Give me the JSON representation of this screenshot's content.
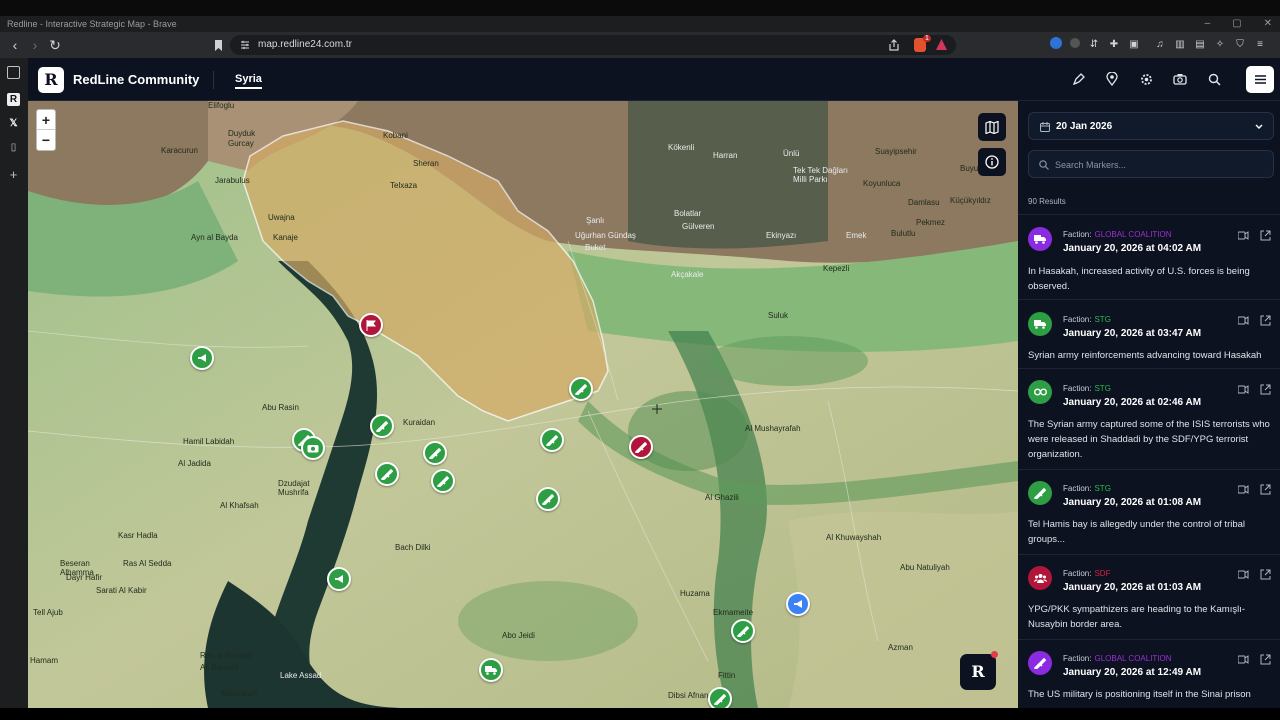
{
  "browser": {
    "window_title": "Redline - Interactive Strategic Map - Brave",
    "url": "map.redline24.com.tr",
    "brave_badge": "1"
  },
  "app": {
    "logo_letter": "R",
    "brand": "RedLine Community",
    "tab": "Syria"
  },
  "map": {
    "zoom_in": "+",
    "zoom_out": "−",
    "labels": [
      "Elifoglu",
      "Duyduk",
      "Gurcay",
      "Karacurun",
      "Kobani",
      "Sheran",
      "Telxaza",
      "Jarabulus",
      "Uwajna",
      "Kanaje",
      "Ayn al Bayda",
      "Kökenli",
      "Harran",
      "Ünlü",
      "Tek Tek Dağları Milli Parkı",
      "Suayipsehir",
      "Koyunluca",
      "Damlasu",
      "Pekmez",
      "Küçükyıldız",
      "Buyu",
      "Şanlı",
      "Uğurhan Gündaş",
      "Buket",
      "Bolatlar",
      "Gülveren",
      "Akçakale",
      "Ekinyazı",
      "Emek",
      "Bulutlu",
      "Kepezli",
      "Suluk",
      "Abu Rasin",
      "Kuraidan",
      "Al Mushayrafah",
      "Hamil Labidah",
      "Al Jadida",
      "Al Khafsah",
      "Dzudajat Mushrifa",
      "Bach Dilki",
      "Kasr Hadla",
      "Beseran Alhamma",
      "Ras Al Sedda",
      "Sarati Al Kabir",
      "Dayr Hafir",
      "Tell Ajub",
      "Ras al Bumani",
      "Ali Bumani",
      "Maskanah",
      "Lake Assad",
      "Abo Jeidi",
      "Al Ghazili",
      "Al Khuwayshah",
      "Abu Natuliyah",
      "Huzama",
      "Ekmameite",
      "Azman",
      "Fittin",
      "Dibsi Afnan",
      "Hamam"
    ]
  },
  "panel": {
    "date": "20 Jan 2026",
    "search_placeholder": "Search Markers...",
    "results": "90 Results",
    "faction_label": "Faction:",
    "items": [
      {
        "faction": "GLOBAL COALITION",
        "faction_color": "#9b2fd4",
        "icon": "truck-icon",
        "icon_bg": "#8a2be2",
        "time": "January 20, 2026 at 04:02 AM",
        "text": "In Hasakah, increased activity of U.S. forces is being observed."
      },
      {
        "faction": "STG",
        "faction_color": "#2eb84b",
        "icon": "truck-icon",
        "icon_bg": "#2e9e44",
        "time": "January 20, 2026 at 03:47 AM",
        "text": "Syrian army reinforcements advancing toward Hasakah"
      },
      {
        "faction": "STG",
        "faction_color": "#2eb84b",
        "icon": "handcuffs-icon",
        "icon_bg": "#2e9e44",
        "time": "January 20, 2026 at 02:46 AM",
        "text": "The Syrian army captured some of the ISIS terrorists who were released in Shaddadi by the SDF/YPG terrorist organization."
      },
      {
        "faction": "STG",
        "faction_color": "#2eb84b",
        "icon": "rifle-icon",
        "icon_bg": "#2e9e44",
        "time": "January 20, 2026 at 01:08 AM",
        "text": "Tel Hamis bay is allegedly under the control of tribal groups..."
      },
      {
        "faction": "SDF",
        "faction_color": "#d4213d",
        "icon": "group-icon",
        "icon_bg": "#b0163a",
        "time": "January 20, 2026 at 01:03 AM",
        "text": "YPG/PKK sympathizers are heading to the Kamışlı-Nusaybin border area."
      },
      {
        "faction": "GLOBAL COALITION",
        "faction_color": "#9b2fd4",
        "icon": "rifle-icon",
        "icon_bg": "#8a2be2",
        "time": "January 20, 2026 at 12:49 AM",
        "text": "The US military is positioning itself in the Sinai prison"
      }
    ]
  },
  "colors": {
    "header_bg": "#0c1220",
    "stg_green": "#2e9e44",
    "sdf_red": "#b0163a",
    "coalition_purple": "#8a2be2",
    "zone_fill": "#d4ab66"
  }
}
